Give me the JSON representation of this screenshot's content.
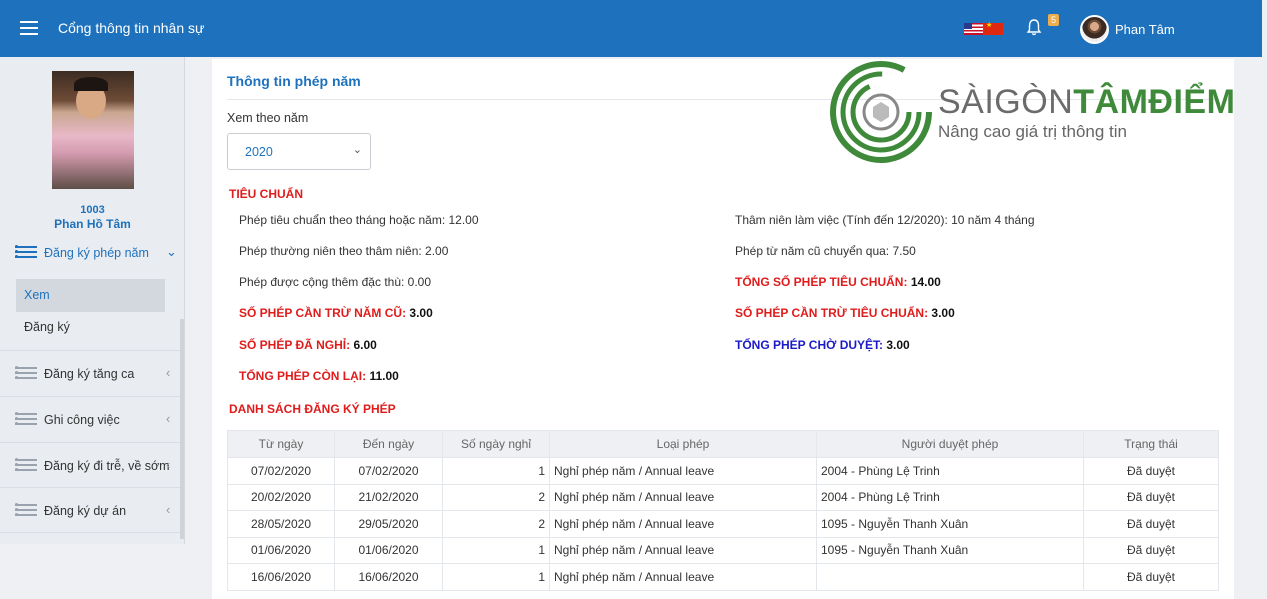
{
  "header": {
    "app_title": "Cổng thông tin nhân sự",
    "notification_count": "5",
    "user_name": "Phan Tâm"
  },
  "sidebar": {
    "employee_id": "1003",
    "employee_name": "Phan Hồ Tâm",
    "menu": [
      {
        "label": "Đăng ký phép năm",
        "state": "expanded"
      },
      {
        "label": "Đăng ký tăng ca"
      },
      {
        "label": "Ghi công việc"
      },
      {
        "label": "Đăng ký đi trễ, về sớm"
      },
      {
        "label": "Đăng ký dự án"
      }
    ],
    "submenu": [
      "Xem",
      "Đăng ký"
    ]
  },
  "main": {
    "title": "Thông tin phép năm",
    "year_label": "Xem theo năm",
    "year_value": "2020",
    "standard_section": "TIÊU CHUẨN",
    "left_items": [
      {
        "text": "Phép tiêu chuẩn theo tháng hoặc năm: 12.00"
      },
      {
        "text": "Phép thường niên theo thâm niên: 2.00"
      },
      {
        "text": "Phép được cộng thêm đặc thù: 0.00"
      }
    ],
    "right_items": [
      {
        "text": "Thâm niên làm việc (Tính đến 12/2020): 10 năm 4 tháng"
      },
      {
        "text": "Phép từ năm cũ chuyển qua: 7.50"
      }
    ],
    "highlights": {
      "total_standard": {
        "label": "TỔNG SỐ PHÉP TIÊU CHUẨN:",
        "value": "14.00"
      },
      "deduct_old": {
        "label": "SỐ PHÉP CẦN TRỪ NĂM CŨ:",
        "value": "3.00"
      },
      "deduct_standard": {
        "label": "SỐ PHÉP CẦN TRỪ TIÊU CHUẨN:",
        "value": "3.00"
      },
      "taken": {
        "label": "SỐ PHÉP ĐÃ NGHỈ:",
        "value": "6.00"
      },
      "pending": {
        "label": "TỔNG PHÉP CHỜ DUYỆT:",
        "value": "3.00"
      },
      "remaining": {
        "label": "TỔNG PHÉP CÒN LẠI:",
        "value": "11.00"
      }
    },
    "list_section": "DANH SÁCH ĐĂNG KÝ PHÉP"
  },
  "watermark": {
    "brand_part1": "SÀIGÒN",
    "brand_part2": "TÂMĐIỂM",
    "slogan": "Nâng cao giá trị thông tin"
  },
  "table": {
    "columns": [
      "Từ ngày",
      "Đến ngày",
      "Số ngày nghỉ",
      "Loại phép",
      "Người duyệt phép",
      "Trạng thái"
    ],
    "rows": [
      [
        "07/02/2020",
        "07/02/2020",
        "1",
        "Nghỉ phép năm / Annual leave",
        "2004 - Phùng Lệ Trinh",
        "Đã duyệt"
      ],
      [
        "20/02/2020",
        "21/02/2020",
        "2",
        "Nghỉ phép năm / Annual leave",
        "2004 - Phùng Lệ Trinh",
        "Đã duyệt"
      ],
      [
        "28/05/2020",
        "29/05/2020",
        "2",
        "Nghỉ phép năm / Annual leave",
        "1095 - Nguyễn Thanh Xuân",
        "Đã duyệt"
      ],
      [
        "01/06/2020",
        "01/06/2020",
        "1",
        "Nghỉ phép năm / Annual leave",
        "1095 - Nguyễn Thanh Xuân",
        "Đã duyệt"
      ],
      [
        "16/06/2020",
        "16/06/2020",
        "1",
        "Nghỉ phép năm / Annual leave",
        "",
        "Đã duyệt"
      ]
    ]
  },
  "colors": {
    "header_blue": "#1e72bd",
    "label_red": "#e01b1b",
    "pending_blue": "#1a1ac8",
    "approved_green": "#1a9b1a"
  }
}
